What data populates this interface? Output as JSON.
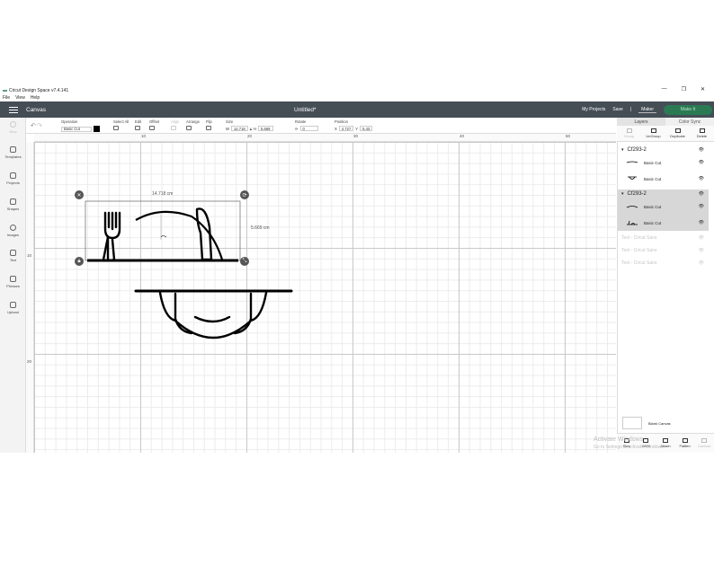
{
  "window": {
    "title": "Cricut Design Space  v7.4.141",
    "controls": [
      "—",
      "❐",
      "✕"
    ]
  },
  "menu": [
    "File",
    "View",
    "Help"
  ],
  "header": {
    "section": "Canvas",
    "doc_title": "Untitled*",
    "my_projects": "My Projects",
    "save": "Save",
    "separator": "|",
    "machine": "Maker",
    "make_it": "Make It",
    "accent_color": "#2b7a54"
  },
  "toolbar": {
    "undo_label": "Undo",
    "operation": {
      "label": "Operation",
      "value": "Basic Cut"
    },
    "select_all": "Select All",
    "edit": "Edit",
    "offset": "Offset",
    "align": "Align",
    "arrange": "Arrange",
    "flip": "Flip",
    "size": {
      "label": "Size",
      "w_label": "W",
      "w": "14.718",
      "h_label": "H",
      "h": "5.669"
    },
    "rotate": {
      "label": "Rotate",
      "value": "0"
    },
    "position": {
      "label": "Position",
      "x_label": "X",
      "x": "4.727",
      "y_label": "Y",
      "y": "5.43"
    }
  },
  "sidebar": {
    "items": [
      {
        "label": "New",
        "icon": "plus-icon",
        "disabled": true
      },
      {
        "label": "Templates",
        "icon": "shirt-icon"
      },
      {
        "label": "Projects",
        "icon": "projects-icon"
      },
      {
        "label": "Shapes",
        "icon": "shapes-icon"
      },
      {
        "label": "Images",
        "icon": "lightbulb-icon"
      },
      {
        "label": "Text",
        "icon": "text-icon"
      },
      {
        "label": "Phrases",
        "icon": "phrases-icon"
      },
      {
        "label": "Upload",
        "icon": "upload-icon"
      }
    ]
  },
  "rulers": {
    "top": [
      "10",
      "20",
      "30",
      "40",
      "50"
    ],
    "left": [
      "10",
      "20"
    ]
  },
  "selection": {
    "width_label": "14.718 cm",
    "height_label": "5.669 cm"
  },
  "panel": {
    "tabs": [
      "Layers",
      "Color Sync"
    ],
    "actions": [
      "Group",
      "UnGroup",
      "Duplicate",
      "Delete"
    ],
    "groups": [
      {
        "name": "Cf293-2",
        "layers": [
          {
            "label": "Basic Cut"
          },
          {
            "label": "Basic Cut"
          }
        ]
      },
      {
        "name": "Cf293-2",
        "layers": [
          {
            "label": "Basic Cut"
          },
          {
            "label": "Basic Cut"
          }
        ]
      }
    ],
    "text_layers": [
      "Text - Cricut Sans",
      "Text - Cricut Sans",
      "Text - Cricut Sans"
    ],
    "blank_canvas": "Blank Canvas",
    "bottom_actions": [
      "Slice",
      "Weld",
      "Attach",
      "Flatten",
      "Contour"
    ]
  },
  "watermark": {
    "line1": "Activate Windows",
    "line2": "Go to Settings to activate Windows."
  }
}
